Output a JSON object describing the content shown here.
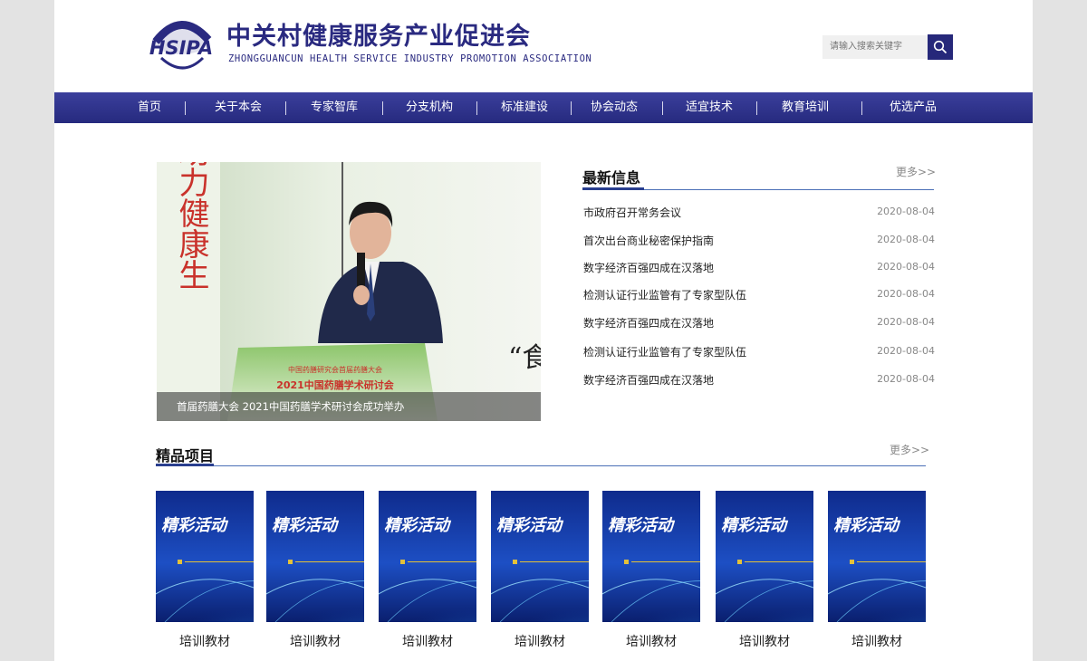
{
  "header": {
    "logo_text": "HSIPA",
    "org_name": "中关村健康服务产业促进会",
    "org_name_en": "ZHONGGUANCUN HEALTH SERVICE INDUSTRY PROMOTION ASSOCIATION",
    "search_placeholder": "请输入搜索关键字",
    "search_icon": "magnifier-icon"
  },
  "nav": {
    "items": [
      "首页",
      "关于本会",
      "专家智库",
      "分支机构",
      "标准建设",
      "协会动态",
      "适宜技术",
      "教育培训",
      "优选产品"
    ]
  },
  "slideshow": {
    "caption": "首届药膳大会 2021中国药膳学术研讨会成功举办",
    "banner_small": "中国药膳研究会首届药膳大会",
    "banner_big": "2021中国药膳学术研讨会",
    "wall_text": "助力健康生",
    "wall_quote": "“食"
  },
  "news": {
    "title": "最新信息",
    "more": "更多>>",
    "items": [
      {
        "title": "市政府召开常务会议",
        "date": "2020-08-04"
      },
      {
        "title": "首次出台商业秘密保护指南",
        "date": "2020-08-04"
      },
      {
        "title": "数字经济百强四成在汉落地",
        "date": "2020-08-04"
      },
      {
        "title": "检测认证行业监管有了专家型队伍",
        "date": "2020-08-04"
      },
      {
        "title": "数字经济百强四成在汉落地",
        "date": "2020-08-04"
      },
      {
        "title": "检测认证行业监管有了专家型队伍",
        "date": "2020-08-04"
      },
      {
        "title": "数字经济百强四成在汉落地",
        "date": "2020-08-04"
      }
    ]
  },
  "products": {
    "title": "精品项目",
    "more": "更多>>",
    "cover_text": "精彩活动",
    "items": [
      {
        "label": "培训教材"
      },
      {
        "label": "培训教材"
      },
      {
        "label": "培训教材"
      },
      {
        "label": "培训教材"
      },
      {
        "label": "培训教材"
      },
      {
        "label": "培训教材"
      },
      {
        "label": "培训教材"
      }
    ]
  },
  "colors": {
    "brand": "#2a2a80",
    "nav_bg": "#2d3186",
    "accent_line": "#4a6fb6"
  }
}
